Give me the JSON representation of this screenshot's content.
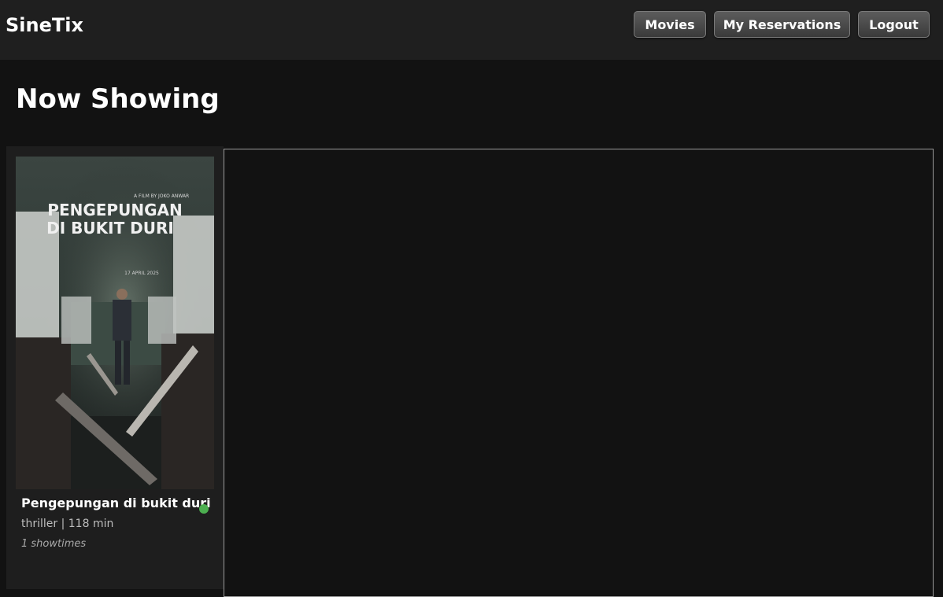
{
  "header": {
    "brand": "SineTix",
    "nav": {
      "movies": "Movies",
      "reservations": "My Reservations",
      "logout": "Logout"
    }
  },
  "main": {
    "title": "Now Showing",
    "movies": [
      {
        "poster": {
          "credit": "A FILM BY JOKO ANWAR",
          "title_line1": "PENGEPUNGAN",
          "title_line2": "DI BUKIT DURI",
          "release": "17 APRIL 2025"
        },
        "title": "Pengepungan di bukit duri",
        "meta": "thriller | 118 min",
        "showtimes": "1 showtimes",
        "status_color": "#4caf50"
      }
    ]
  }
}
